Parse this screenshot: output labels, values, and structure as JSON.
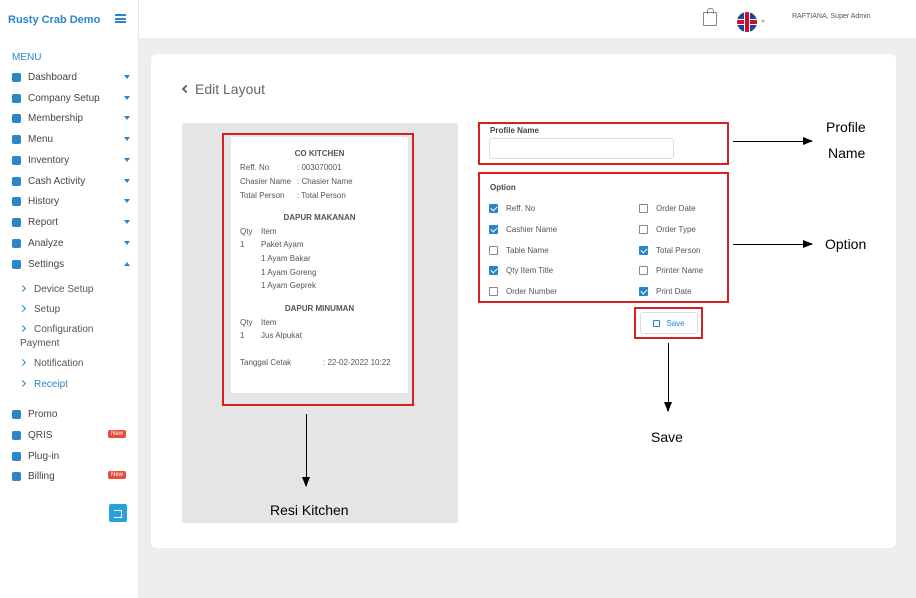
{
  "brand": "Rusty Crab Demo",
  "menu_title": "MENU",
  "nav": [
    {
      "label": "Dashboard",
      "icon": "dashboard-icon"
    },
    {
      "label": "Company Setup",
      "icon": "building-icon"
    },
    {
      "label": "Membership",
      "icon": "users-icon"
    },
    {
      "label": "Menu",
      "icon": "cutlery-icon"
    },
    {
      "label": "Inventory",
      "icon": "inventory-icon"
    },
    {
      "label": "Cash Activity",
      "icon": "dollar-icon"
    },
    {
      "label": "History",
      "icon": "history-icon"
    },
    {
      "label": "Report",
      "icon": "report-icon"
    },
    {
      "label": "Analyze",
      "icon": "pie-chart-icon"
    },
    {
      "label": "Settings",
      "icon": "gear-icon"
    }
  ],
  "settings_sub": [
    "Device Setup",
    "Setup",
    "Configuration",
    "Payment",
    "Notification",
    "Receipt"
  ],
  "nav_bottom": [
    {
      "label": "Promo",
      "icon": "percent-icon"
    },
    {
      "label": "QRIS",
      "icon": "qr-icon",
      "badge": "New"
    },
    {
      "label": "Plug-in",
      "icon": "plugin-icon"
    },
    {
      "label": "Billing",
      "icon": "billing-icon",
      "badge": "New"
    }
  ],
  "user": "RAFTIANA, Super Admin",
  "page_title": "Edit Layout",
  "receipt": {
    "title": "CO KITCHEN",
    "reff_label": "Reff. No",
    "reff_value": ": 003070001",
    "cashier_label": "Chasier Name",
    "cashier_value": ": Chasier Name",
    "total_label": "Total Person",
    "total_value": ": Total Person",
    "section1": "DAPUR MAKANAN",
    "qty": "Qty",
    "item": "Item",
    "s1_qty": "1",
    "s1_item": "Paket Ayam",
    "s1_sub1": "1 Ayam Bakar",
    "s1_sub2": "1 Ayam Goreng",
    "s1_sub3": "1 Ayam Geprek",
    "section2": "DAPUR MINUMAN",
    "s2_qty": "1",
    "s2_item": "Jus Alpukat",
    "print_label": "Tanggal Cetak",
    "print_value": ": 22-02-2022 10:22"
  },
  "profile_name_label": "Profile Name",
  "profile_name_value": "",
  "option_label": "Option",
  "options": [
    {
      "label": "Reff. No",
      "checked": true
    },
    {
      "label": "Order Date",
      "checked": false
    },
    {
      "label": "Cashier Name",
      "checked": true
    },
    {
      "label": "Order Type",
      "checked": false
    },
    {
      "label": "Table Name",
      "checked": false
    },
    {
      "label": "Total Person",
      "checked": true
    },
    {
      "label": "Qty Item Title",
      "checked": true
    },
    {
      "label": "Printer Name",
      "checked": false
    },
    {
      "label": "Order Number",
      "checked": false
    },
    {
      "label": "Print Date",
      "checked": true
    }
  ],
  "save_label": "Save",
  "annotations": {
    "profile_line1": "Profile",
    "profile_line2": "Name",
    "option": "Option",
    "save": "Save",
    "resi": "Resi Kitchen"
  },
  "colors": {
    "accent": "#2a86c8",
    "annotation_box": "#d71f1f",
    "badge": "#e74c3c"
  }
}
